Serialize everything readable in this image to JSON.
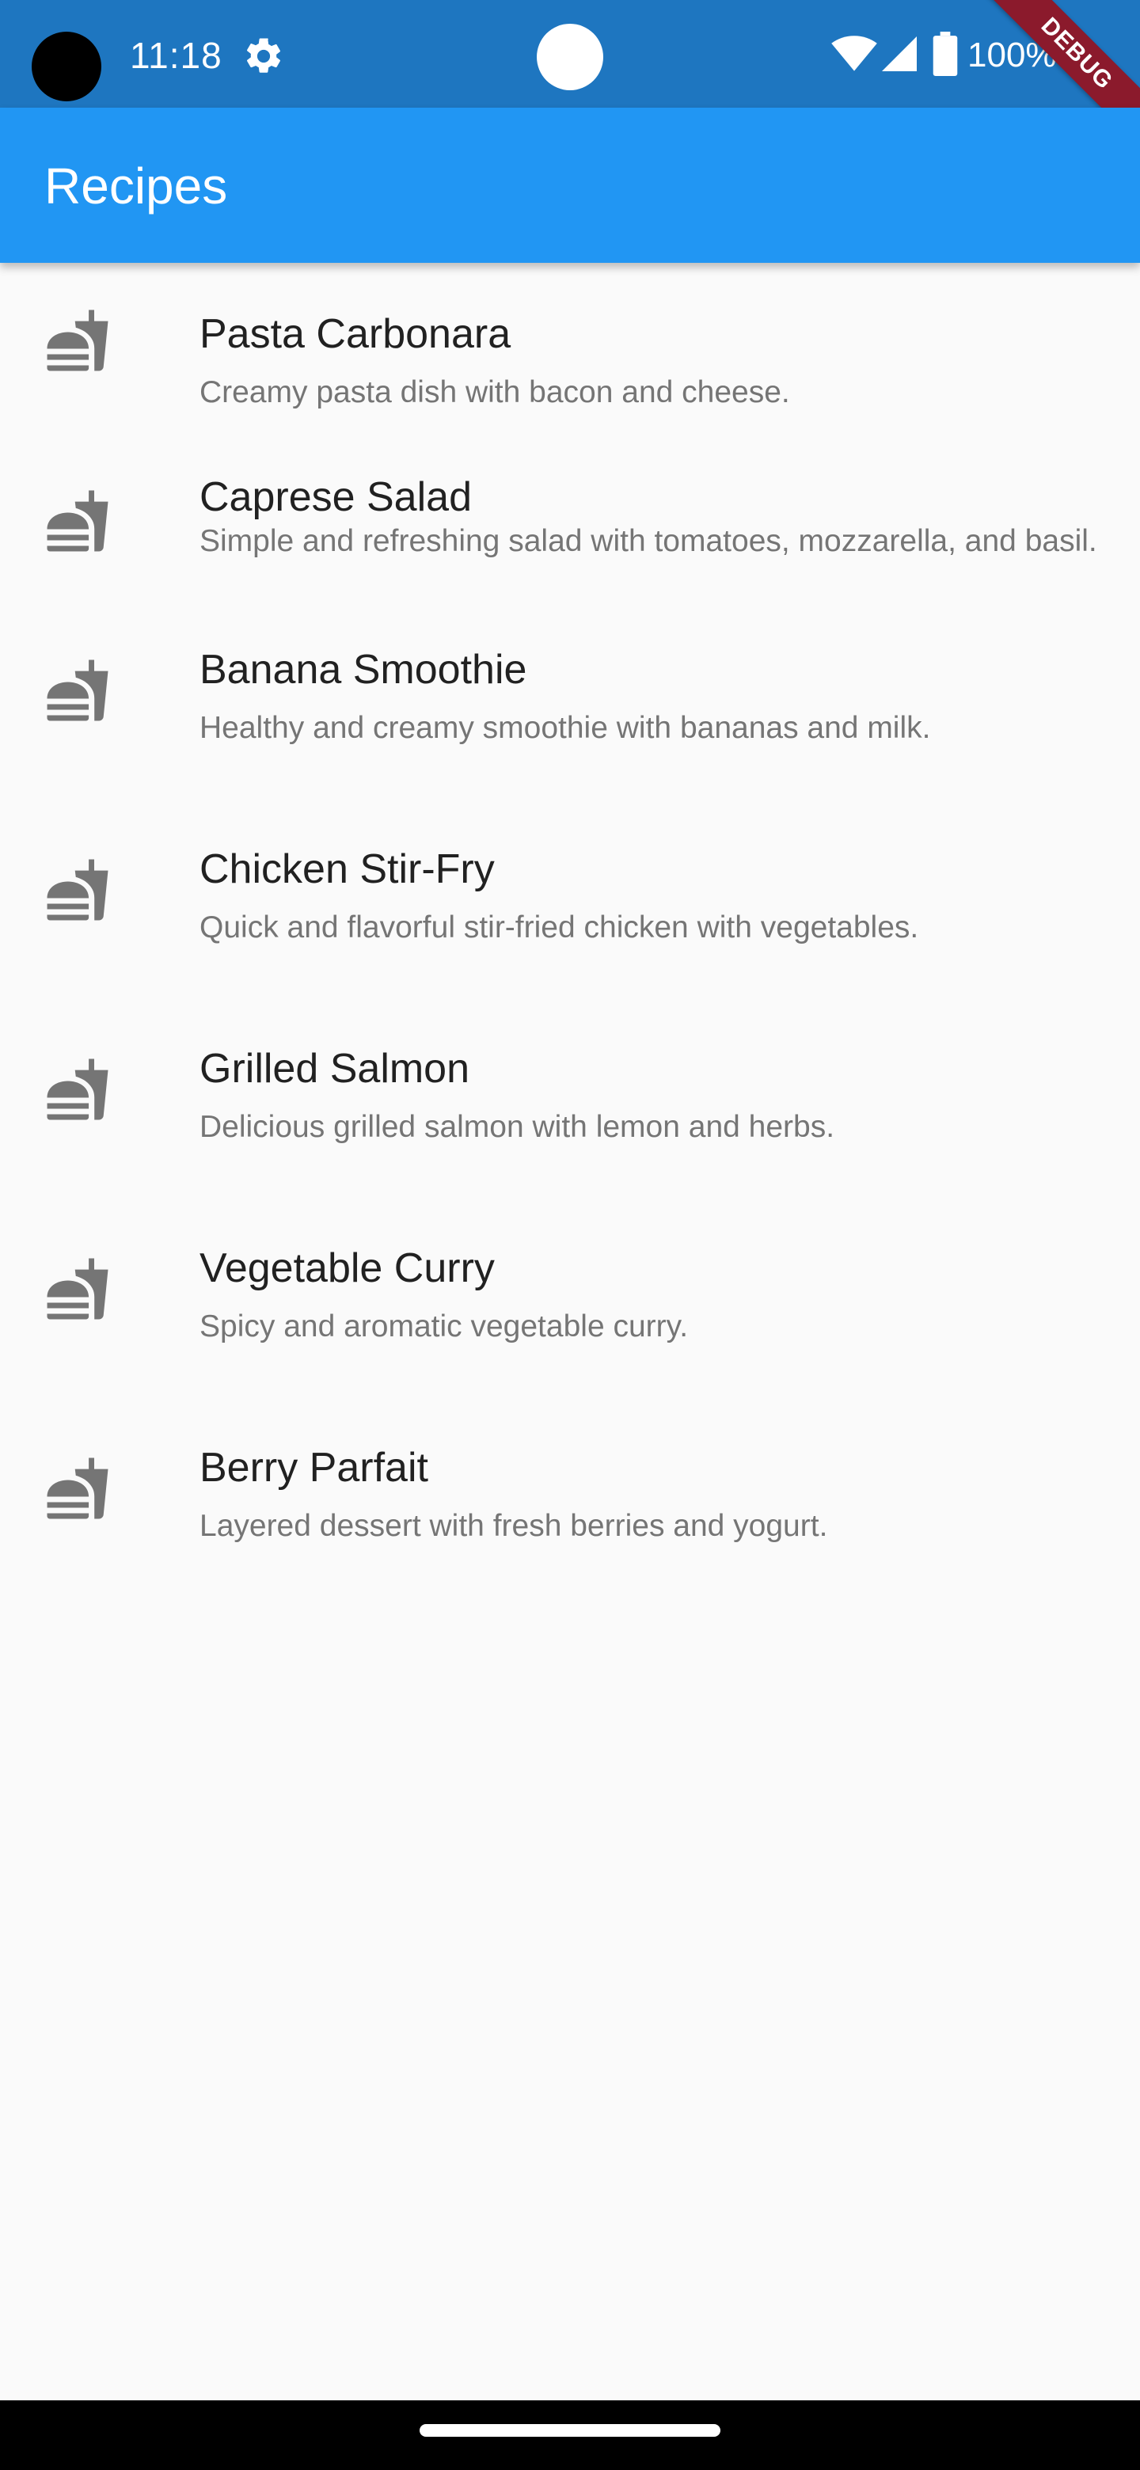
{
  "status_bar": {
    "time": "11:18",
    "battery": "100%",
    "icons": [
      "gear-icon",
      "wifi-icon",
      "signal-icon",
      "battery-icon"
    ]
  },
  "debug_banner": "DEBUG",
  "app_bar": {
    "title": "Recipes",
    "color": "#2196f3"
  },
  "recipes": [
    {
      "title": "Pasta Carbonara",
      "description": "Creamy pasta dish with bacon and cheese.",
      "icon": "fastfood-icon"
    },
    {
      "title": "Caprese Salad",
      "description": "Simple and refreshing salad with tomatoes, mozzarella, and basil.",
      "icon": "fastfood-icon"
    },
    {
      "title": "Banana Smoothie",
      "description": "Healthy and creamy smoothie with bananas and milk.",
      "icon": "fastfood-icon"
    },
    {
      "title": "Chicken Stir-Fry",
      "description": "Quick and flavorful stir-fried chicken with vegetables.",
      "icon": "fastfood-icon"
    },
    {
      "title": "Grilled Salmon",
      "description": "Delicious grilled salmon with lemon and herbs.",
      "icon": "fastfood-icon"
    },
    {
      "title": "Vegetable Curry",
      "description": "Spicy and aromatic vegetable curry.",
      "icon": "fastfood-icon"
    },
    {
      "title": "Berry Parfait",
      "description": "Layered dessert with fresh berries and yogurt.",
      "icon": "fastfood-icon"
    }
  ]
}
